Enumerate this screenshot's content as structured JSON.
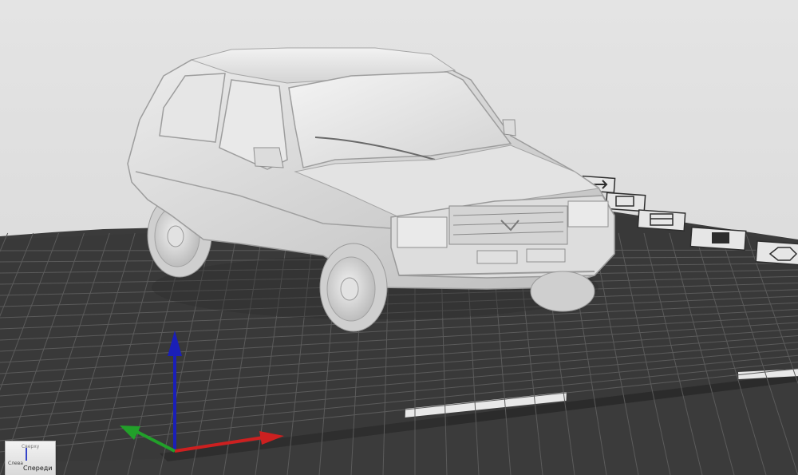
{
  "view_cube": {
    "front_label": "Спереди",
    "left_label": "Слева",
    "top_label": "Сверху"
  },
  "colors": {
    "background": "#e0e0e0",
    "build_plate": "#3a3a3a",
    "plate_grid": "#5b5b5b",
    "model": "#d9d9d9",
    "axis_x": "#cc2020",
    "axis_y": "#22a02a",
    "axis_z": "#1a1fb8"
  },
  "icons": [
    "wrench-settings-icon",
    "monitor-icon",
    "layout-icon",
    "fill-icon",
    "rotate-icon"
  ]
}
